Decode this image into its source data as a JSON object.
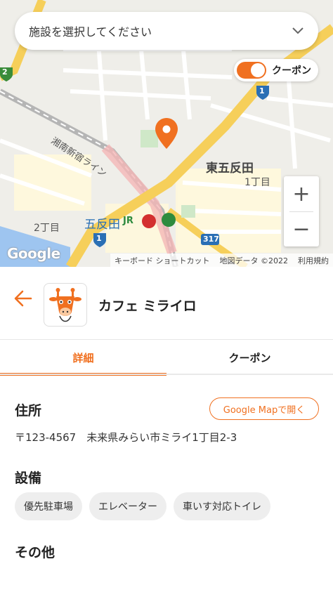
{
  "map": {
    "place_select": {
      "label": "施設を選択してください"
    },
    "coupon_toggle": {
      "label": "クーポン",
      "on": true
    },
    "labels": {
      "higashi_gotanda": "東五反田",
      "chome1": "1丁目",
      "chome2": "2丁目",
      "gotanda": "五反田",
      "shonan_line": "湘南新宿ライン",
      "jr": "JR",
      "route1a": "1",
      "route1b": "1",
      "route317": "317",
      "route2": "2"
    },
    "zoom": {
      "in": "+",
      "out": "−"
    },
    "google": "Google",
    "attribution": {
      "shortcuts": "キーボード ショートカット",
      "data": "地図データ ©2022",
      "terms": "利用規約"
    }
  },
  "shop": {
    "name": "カフェ ミライロ"
  },
  "tabs": [
    {
      "label": "詳細",
      "active": true
    },
    {
      "label": "クーポン",
      "active": false
    }
  ],
  "address": {
    "title": "住所",
    "map_button": "Google Mapで開く",
    "text": "〒123-4567　未来県みらい市ミライ1丁目2-3"
  },
  "facilities": {
    "title": "設備",
    "items": [
      "優先駐車場",
      "エレベーター",
      "車いす対応トイレ"
    ]
  },
  "other": {
    "title": "その他"
  },
  "colors": {
    "accent": "#f07020"
  }
}
